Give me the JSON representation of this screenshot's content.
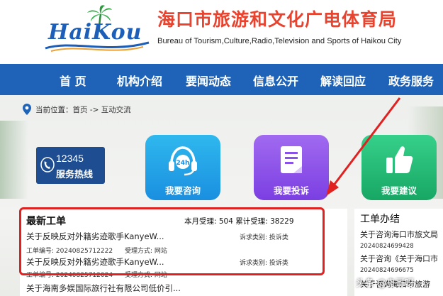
{
  "header": {
    "logo_text": "HaiKou",
    "title": "海口市旅游和文化广电体育局",
    "subtitle": "Bureau of Tourism,Culture,Radio,Television and Sports of Haikou City"
  },
  "nav": {
    "items": [
      "首 页",
      "机构介绍",
      "要闻动态",
      "信息公开",
      "解读回应",
      "政务服务"
    ]
  },
  "breadcrumb": {
    "label": "当前位置：首页 -> 互动交流"
  },
  "hotline": {
    "number": "12345",
    "label": "服务热线"
  },
  "tiles": {
    "consult": "我要咨询",
    "complain": "我要投诉",
    "suggest": "我要建议",
    "consult_badge": "24h"
  },
  "work_orders": {
    "title": "最新工单",
    "stats": "本月受理: 504  累计受理: 38229",
    "items": [
      {
        "title": "关于反映反对外籍劣迹歌手KanyeW...",
        "type": "诉求类别: 投诉类",
        "number": "工单编号: 20240825712222",
        "method": "受理方式: 网站"
      },
      {
        "title": "关于反映反对外籍劣迹歌手KanyeW...",
        "type": "诉求类别: 投诉类",
        "number": "工单编号: 20240825712024",
        "method": "受理方式: 网站"
      },
      {
        "title": "关于海南多娱国际旅行社有限公司低价引..."
      }
    ]
  },
  "side": {
    "title": "工单办结",
    "lines": [
      "关于咨询海口市旅文局",
      "20240824699428",
      "关于咨询《关于海口市",
      "20240824696675",
      "关于咨询海口市旅游"
    ]
  },
  "watermark": "头条 @舟哥呀",
  "colors": {
    "nav_bg": "#1e63b8",
    "title_red": "#e8432e",
    "highlight_red": "#e12020",
    "hotline_bg": "#1e4e91"
  }
}
